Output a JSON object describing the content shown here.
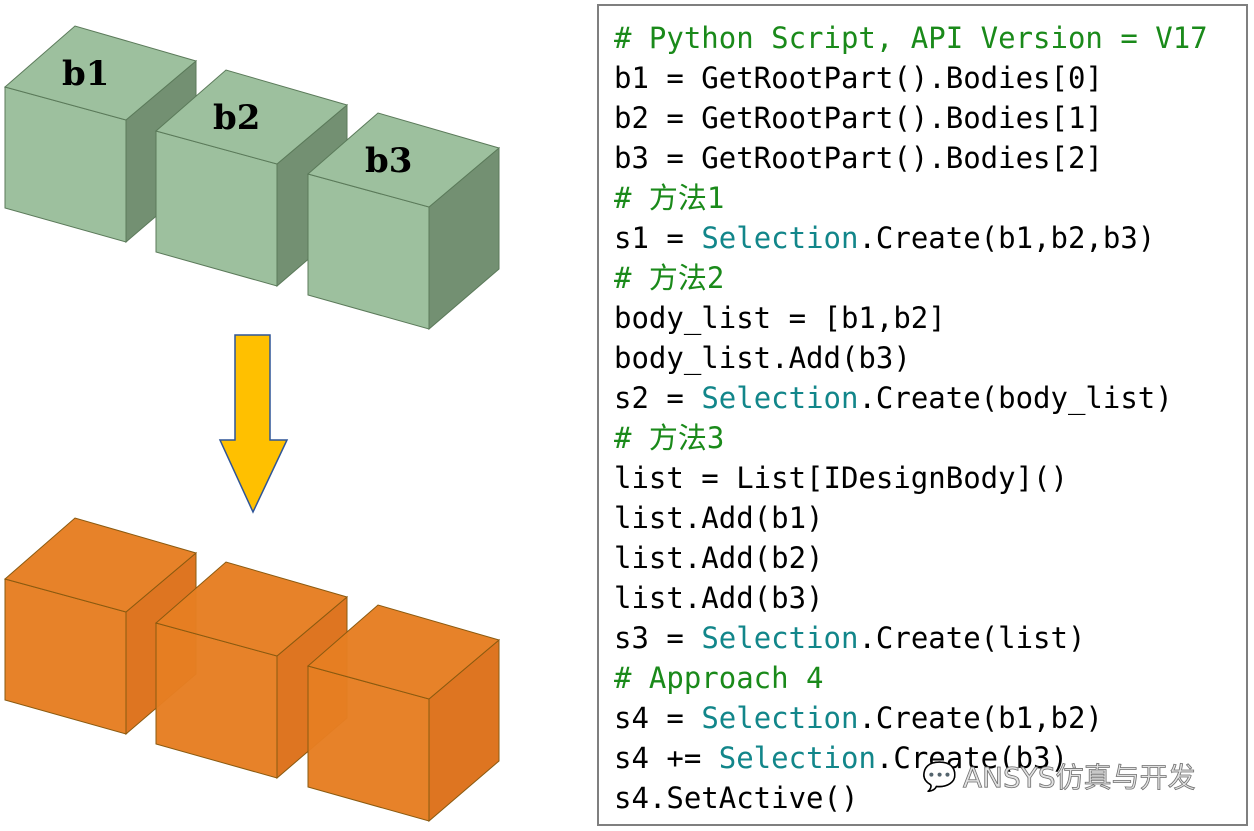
{
  "colors": {
    "green_cube": "#9dc09e",
    "orange_cube": "#e67e22",
    "arrow": "#ffc000",
    "comment": "#1a8a1a",
    "type": "#12868a"
  },
  "cube_labels": [
    "b1",
    "b2",
    "b3"
  ],
  "code_lines": [
    [
      {
        "t": "# Python Script, API Version = V17",
        "c": "cm"
      }
    ],
    [
      {
        "t": "b1 = GetRootPart().Bodies[0]"
      }
    ],
    [
      {
        "t": "b2 = GetRootPart().Bodies[1]"
      }
    ],
    [
      {
        "t": "b3 = GetRootPart().Bodies[2]"
      }
    ],
    [
      {
        "t": "# 方法1",
        "c": "cm"
      }
    ],
    [
      {
        "t": "s1 = "
      },
      {
        "t": "Selection",
        "c": "ty"
      },
      {
        "t": ".Create(b1,b2,b3)"
      }
    ],
    [
      {
        "t": "# 方法2",
        "c": "cm"
      }
    ],
    [
      {
        "t": "body_list = [b1,b2]"
      }
    ],
    [
      {
        "t": "body_list.Add(b3)"
      }
    ],
    [
      {
        "t": "s2 = "
      },
      {
        "t": "Selection",
        "c": "ty"
      },
      {
        "t": ".Create(body_list)"
      }
    ],
    [
      {
        "t": "# 方法3",
        "c": "cm"
      }
    ],
    [
      {
        "t": "list = List[IDesignBody]()"
      }
    ],
    [
      {
        "t": "list.Add(b1)"
      }
    ],
    [
      {
        "t": "list.Add(b2)"
      }
    ],
    [
      {
        "t": "list.Add(b3)"
      }
    ],
    [
      {
        "t": "s3 = "
      },
      {
        "t": "Selection",
        "c": "ty"
      },
      {
        "t": ".Create(list)"
      }
    ],
    [
      {
        "t": "# Approach 4",
        "c": "cm"
      }
    ],
    [
      {
        "t": "s4 = "
      },
      {
        "t": "Selection",
        "c": "ty"
      },
      {
        "t": ".Create(b1,b2)"
      }
    ],
    [
      {
        "t": "s4 += "
      },
      {
        "t": "Selection",
        "c": "ty"
      },
      {
        "t": ".Create(b3)"
      }
    ],
    [
      {
        "t": "s4.SetActive()"
      }
    ]
  ],
  "watermark": {
    "icon": "wechat-icon",
    "text": "ANSYS仿真与开发"
  }
}
